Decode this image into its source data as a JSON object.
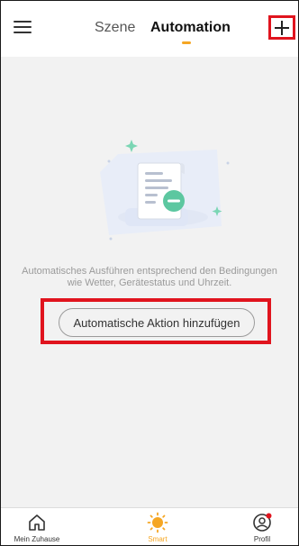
{
  "header": {
    "menu_icon": "hamburger-menu-icon",
    "tabs": [
      {
        "label": "Szene",
        "active": false
      },
      {
        "label": "Automation",
        "active": true
      }
    ],
    "add_icon": "plus-icon"
  },
  "empty_state": {
    "illustration_icon": "document-remove-icon",
    "description_line1": "Automatisches Ausführen entsprechend den Bedingungen",
    "description_line2": "wie Wetter, Gerätestatus und Uhrzeit.",
    "action_label": "Automatische Aktion hinzufügen"
  },
  "bottom_nav": {
    "items": [
      {
        "label": "Mein Zuhause",
        "icon": "home-icon",
        "active": false
      },
      {
        "label": "Smart",
        "icon": "sun-icon",
        "active": true
      },
      {
        "label": "Profil",
        "icon": "profile-icon",
        "active": false
      }
    ]
  },
  "colors": {
    "accent": "#f5a623",
    "highlight": "#e0141e",
    "illustration_green": "#5cc7a0",
    "background": "#f2f2f2"
  }
}
